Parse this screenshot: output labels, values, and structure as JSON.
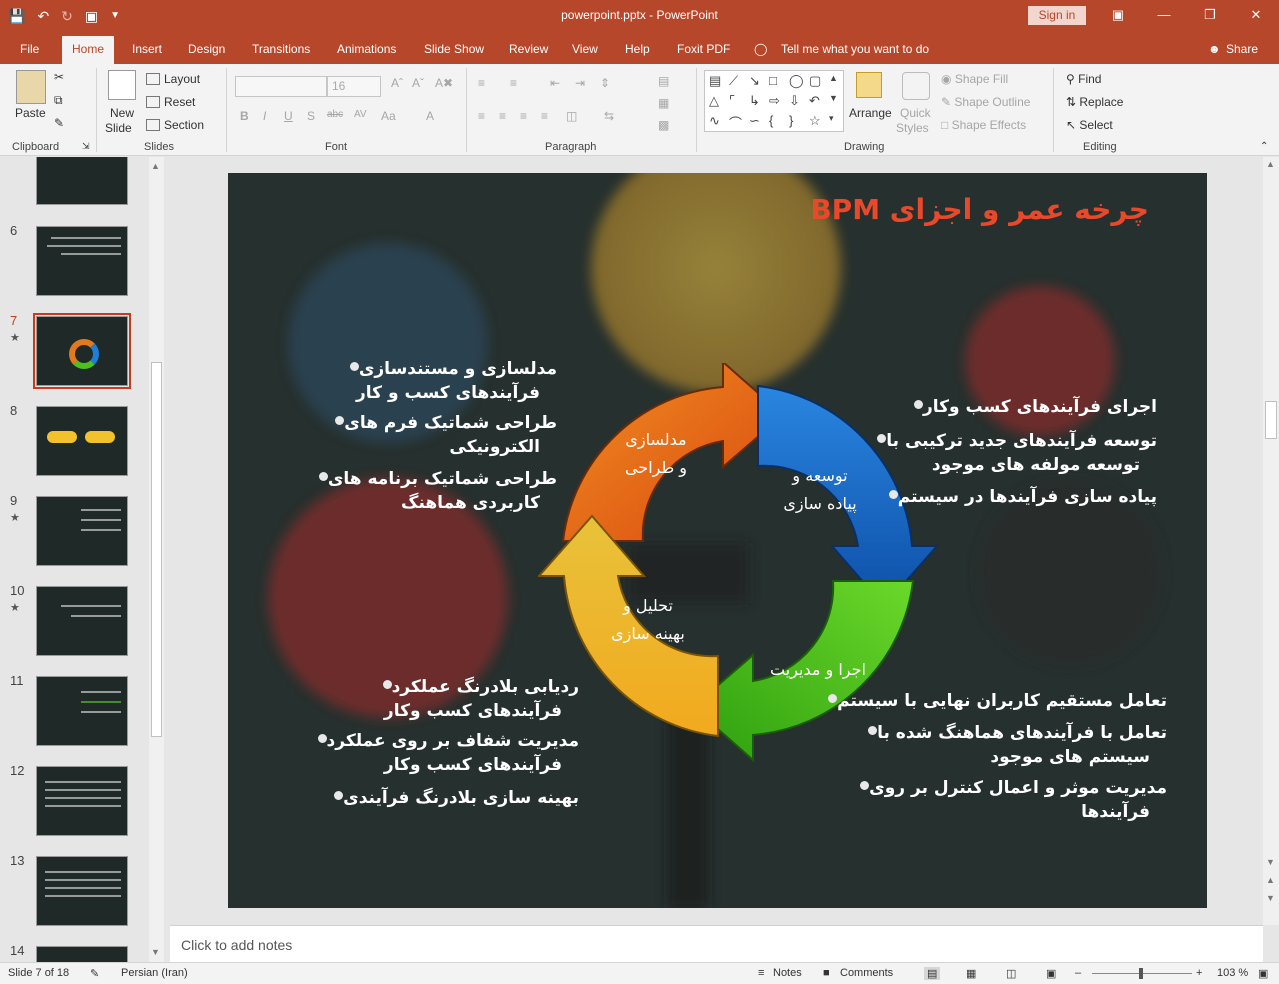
{
  "window": {
    "title": "powerpoint.pptx - PowerPoint",
    "sign_in": "Sign in"
  },
  "tabs": [
    "File",
    "Home",
    "Insert",
    "Design",
    "Transitions",
    "Animations",
    "Slide Show",
    "Review",
    "View",
    "Help",
    "Foxit PDF"
  ],
  "tell_me": "Tell me what you want to do",
  "share": "Share",
  "ribbon": {
    "clipboard": {
      "label": "Clipboard",
      "paste": "Paste"
    },
    "slides": {
      "label": "Slides",
      "new_slide": "New",
      "new_slide2": "Slide",
      "layout": "Layout",
      "reset": "Reset",
      "section": "Section"
    },
    "font": {
      "label": "Font",
      "size": "16"
    },
    "paragraph": {
      "label": "Paragraph"
    },
    "drawing": {
      "label": "Drawing",
      "arrange": "Arrange",
      "quick_styles": "Quick",
      "quick_styles2": "Styles",
      "shape_fill": "Shape Fill",
      "shape_outline": "Shape Outline",
      "shape_effects": "Shape Effects"
    },
    "editing": {
      "label": "Editing",
      "find": "Find",
      "replace": "Replace",
      "select": "Select"
    }
  },
  "thumbnails": [
    {
      "num": "6",
      "star": ""
    },
    {
      "num": "7",
      "star": "★"
    },
    {
      "num": "8",
      "star": ""
    },
    {
      "num": "9",
      "star": "★"
    },
    {
      "num": "10",
      "star": "★"
    },
    {
      "num": "11",
      "star": ""
    },
    {
      "num": "12",
      "star": ""
    },
    {
      "num": "13",
      "star": ""
    },
    {
      "num": "14",
      "star": ""
    }
  ],
  "slide": {
    "title": "چرخه عمر و اجزای BPM",
    "cycle": {
      "design": [
        "مدلسازی",
        "و طراحی"
      ],
      "develop": [
        "توسعه و",
        "پیاده سازی"
      ],
      "execute": [
        "اجرا و مدیریت"
      ],
      "analyze": [
        "تحلیل و",
        "بهینه سازی"
      ]
    },
    "top_left": [
      [
        "مدلسازی و مستندسازی",
        "فرآیندهای کسب و کار"
      ],
      [
        "طراحی شماتیک فرم های",
        "الکترونیکی"
      ],
      [
        "طراحی شماتیک برنامه های",
        "کاربردی هماهنگ"
      ]
    ],
    "top_right": [
      [
        "اجرای فرآیندهای کسب وکار"
      ],
      [
        "توسعه فرآیندهای جدید ترکیبی با",
        "توسعه مولفه های موجود"
      ],
      [
        "پیاده سازی فرآیندها در سیستم"
      ]
    ],
    "bottom_left": [
      [
        "ردیابی بلادرنگ عملکرد",
        "فرآیندهای کسب وکار"
      ],
      [
        "مدیریت شفاف بر روی عملکرد",
        "فرآیندهای کسب وکار"
      ],
      [
        "بهینه سازی بلادرنگ فرآیندی"
      ]
    ],
    "bottom_right": [
      [
        "تعامل مستقیم کاربران نهایی با سیستم"
      ],
      [
        "تعامل با فرآیندهای هماهنگ شده با",
        "سیستم های  موجود"
      ],
      [
        "مدیریت موثر و اعمال کنترل بر روی",
        "فرآیندها"
      ]
    ]
  },
  "notes_placeholder": "Click to add notes",
  "status": {
    "slide": "Slide 7 of 18",
    "language": "Persian (Iran)",
    "notes": "Notes",
    "comments": "Comments",
    "zoom": "103 %"
  }
}
